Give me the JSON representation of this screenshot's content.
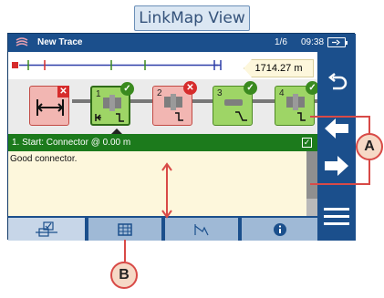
{
  "view_label": "LinkMap View",
  "status_bar": {
    "title": "New Trace",
    "pages": "1/6",
    "time": "09:38"
  },
  "trace": {
    "distance": "1714.27 m"
  },
  "events": [
    {
      "number": "",
      "status": "fail",
      "icon": "launch-fiber-icon"
    },
    {
      "number": "1",
      "status": "pass",
      "icon": "connector-icon",
      "selected": true
    },
    {
      "number": "2",
      "status": "fail",
      "icon": "connector-icon"
    },
    {
      "number": "3",
      "status": "pass",
      "icon": "splice-icon"
    },
    {
      "number": "4",
      "status": "pass",
      "icon": "connector-icon"
    }
  ],
  "selected_event": {
    "header": "1. Start: Connector @ 0.00 m",
    "description": "Good connector."
  },
  "tabs": [
    {
      "name": "linkmap-tab",
      "icon": "linkmap-icon"
    },
    {
      "name": "table-tab",
      "icon": "table-icon"
    },
    {
      "name": "trace-tab",
      "icon": "trace-icon"
    },
    {
      "name": "info-tab",
      "icon": "info-icon"
    }
  ],
  "side_buttons": [
    "back-icon",
    "previous-event-icon",
    "next-event-icon",
    "menu-icon"
  ],
  "callouts": {
    "a": "A",
    "b": "B"
  },
  "colors": {
    "frame": "#1b4f8c",
    "pass": "#9ed566",
    "fail": "#f2b6b2",
    "header_green": "#1c7a1c",
    "annotation_red": "#d84a47"
  }
}
